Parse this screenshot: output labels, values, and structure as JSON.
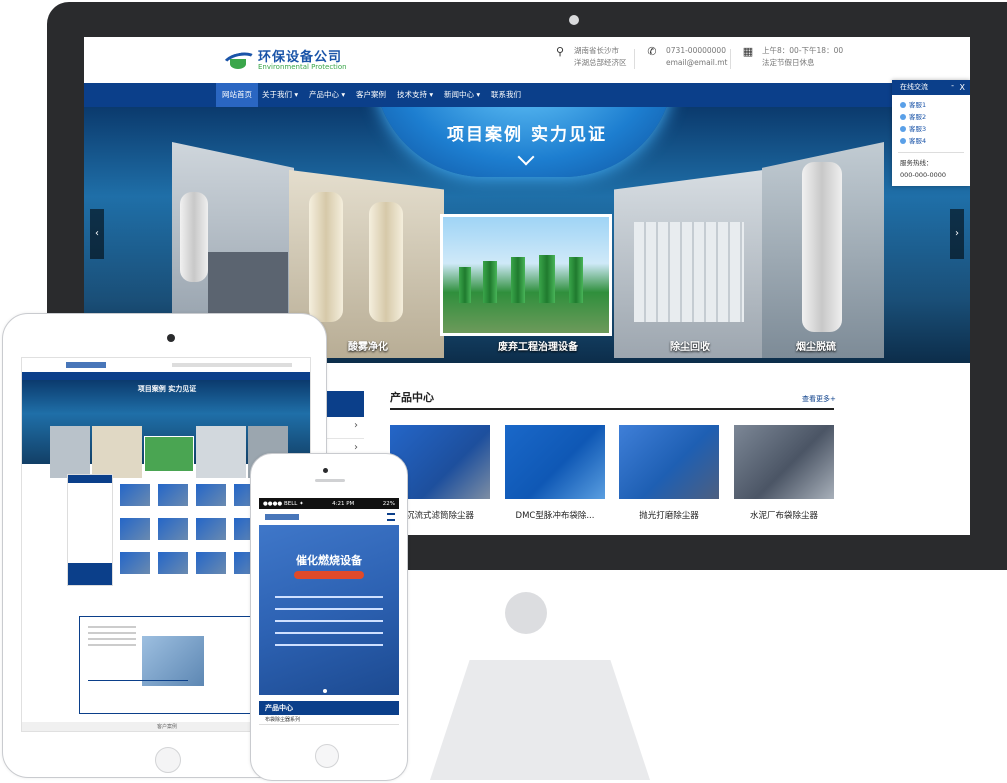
{
  "site": {
    "logo_cn": "环保设备公司",
    "logo_en": "Environmental Protection",
    "address_line1": "湖南省长沙市",
    "address_line2": "洋湖总部经济区",
    "phone": "0731-00000000",
    "email": "email@email.mt",
    "hours_line1": "上午8：00-下午18：00",
    "hours_line2": "法定节假日休息"
  },
  "nav": {
    "items": [
      {
        "label": "网站首页"
      },
      {
        "label": "关于我们 ▾"
      },
      {
        "label": "产品中心 ▾"
      },
      {
        "label": "客户案例"
      },
      {
        "label": "技术支持 ▾"
      },
      {
        "label": "新闻中心 ▾"
      },
      {
        "label": "联系我们"
      }
    ]
  },
  "banner": {
    "title": "项目案例 实力见证",
    "captions": [
      "酸雾净化",
      "废弃工程治理设备",
      "除尘回收",
      "烟尘脱硫"
    ],
    "prev": "‹",
    "next": "›"
  },
  "chat": {
    "title": "在线交流",
    "minimize": "-",
    "close": "X",
    "agents": [
      "客服1",
      "客服2",
      "客服3",
      "客服4"
    ],
    "hotline_label": "服务热线：",
    "hotline": "000-000-0000"
  },
  "products": {
    "title": "产品中心",
    "more": "查看更多+",
    "items": [
      {
        "name": "沉流式滤筒除尘器"
      },
      {
        "name": "DMC型脉冲布袋除..."
      },
      {
        "name": "抛光打磨除尘器"
      },
      {
        "name": "水泥厂布袋除尘器"
      }
    ]
  },
  "tablet": {
    "banner_title": "项目案例 实力见证",
    "footer": "客户案例"
  },
  "phone": {
    "carrier": "●●●● BELL ✦",
    "time": "4:21 PM",
    "battery": "22%",
    "banner_title": "催化燃烧设备",
    "section_title": "产品中心",
    "row1": "布袋除尘器系列"
  },
  "colors": {
    "brand_blue": "#0b3f8a",
    "nav_active": "#2a66c2",
    "logo_green": "#3aa64a"
  }
}
